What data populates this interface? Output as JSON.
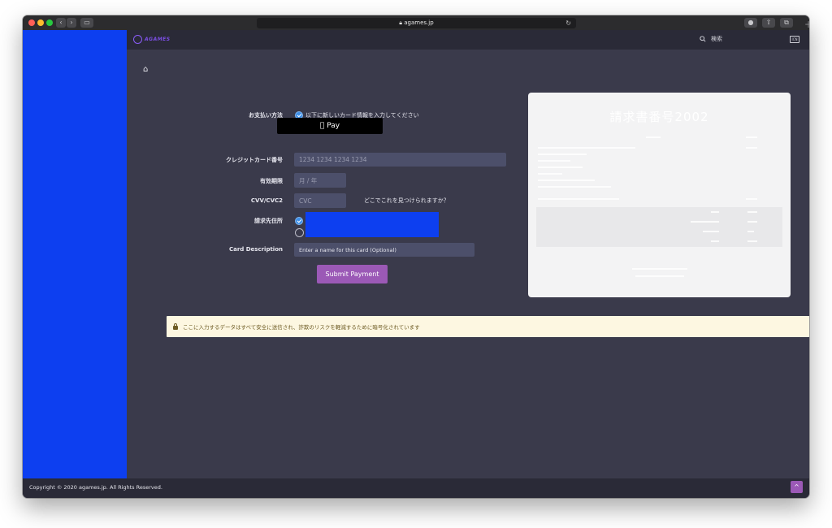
{
  "browser": {
    "url": "agames.jp",
    "tab_new": "+"
  },
  "nav": {
    "logo_text": "AGAMES",
    "search_label": "検索",
    "icon_label": "ICN"
  },
  "form": {
    "payment_method_label": "お支払い方法",
    "new_card_option": "以下に新しいカード情報を入力してください",
    "apple_pay_label": "Pay",
    "card_number_label": "クレジットカード番号",
    "card_number_placeholder": "1234 1234 1234 1234",
    "expiry_label": "有効期限",
    "expiry_placeholder": "月 / 年",
    "cvc_label": "CVV/CVC2",
    "cvc_placeholder": "CVC",
    "cvc_help": "どこでこれを見つけられますか？",
    "billing_label": "請求先住所",
    "card_desc_label": "Card Description",
    "card_desc_placeholder": "Enter a name for this card (Optional)",
    "submit_label": "Submit Payment"
  },
  "invoice": {
    "title": "請求書番号2002"
  },
  "notice": {
    "text": "ここに入力するデータはすべて安全に送信され、詐欺のリスクを軽減するために暗号化されています"
  },
  "footer": {
    "copyright": "Copyright © 2020 agames.jp. All Rights Reserved.",
    "to_top": "^"
  }
}
